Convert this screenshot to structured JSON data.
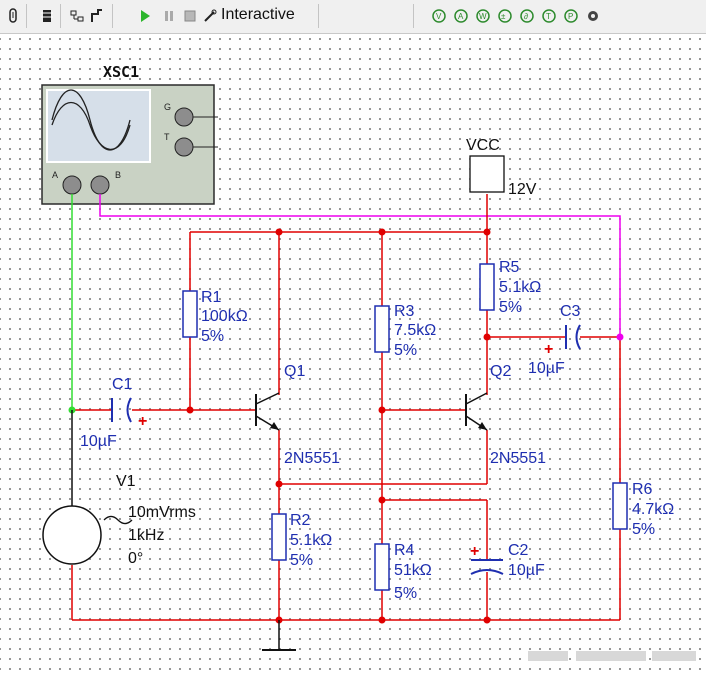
{
  "toolbar": {
    "mode_label": "Interactive",
    "icons": [
      "probe-icon",
      "component-icon",
      "bus-icon",
      "wire-icon",
      "run-icon",
      "pause-icon",
      "stop-icon",
      "pen-icon",
      "analysis-icon-1",
      "analysis-icon-2",
      "analysis-icon-3",
      "analysis-icon-4",
      "analysis-icon-5",
      "analysis-icon-6",
      "analysis-icon-7",
      "settings-icon"
    ]
  },
  "oscilloscope": {
    "label": "XSC1",
    "terminals": {
      "g": "G",
      "t": "T",
      "a": "A",
      "b": "B"
    }
  },
  "vcc": {
    "label": "VCC",
    "value": "12V"
  },
  "source": {
    "name": "V1",
    "amplitude": "10mVrms",
    "frequency": "1kHz",
    "phase": "0°"
  },
  "components": {
    "r1": {
      "name": "R1",
      "value": "100kΩ",
      "tol": "5%"
    },
    "r2": {
      "name": "R2",
      "value": "5.1kΩ",
      "tol": "5%"
    },
    "r3": {
      "name": "R3",
      "value": "7.5kΩ",
      "tol": "5%"
    },
    "r4": {
      "name": "R4",
      "value": "51kΩ",
      "tol": "5%"
    },
    "r5": {
      "name": "R5",
      "value": "5.1kΩ",
      "tol": "5%"
    },
    "r6": {
      "name": "R6",
      "value": "4.7kΩ",
      "tol": "5%"
    },
    "c1": {
      "name": "C1",
      "value": "10µF"
    },
    "c2": {
      "name": "C2",
      "value": "10µF"
    },
    "c3": {
      "name": "C3",
      "value": "10µF"
    },
    "q1": {
      "name": "Q1",
      "model": "2N5551"
    },
    "q2": {
      "name": "Q2",
      "model": "2N5551"
    }
  },
  "colors": {
    "wire": "#e00000",
    "input_probe": "#33dd33",
    "output_probe": "#ee00ee",
    "label": "#1f2fb0",
    "junction": "#e00000"
  }
}
